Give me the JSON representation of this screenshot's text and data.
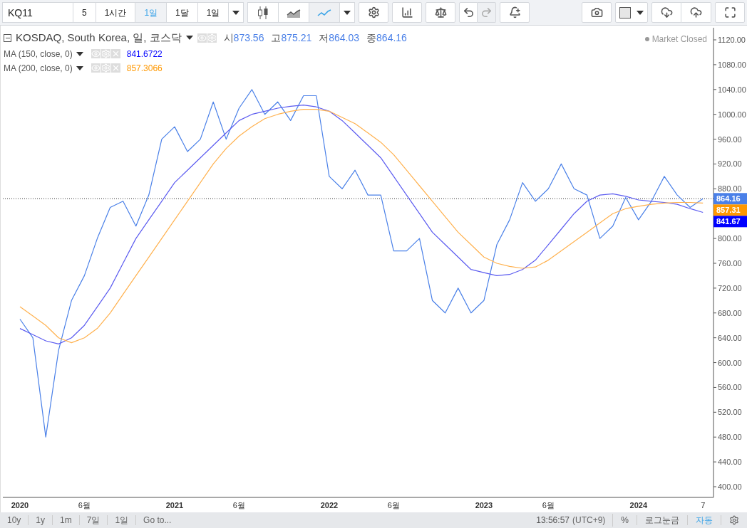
{
  "toolbar": {
    "symbol": "KQ11",
    "intervals": [
      {
        "label": "5",
        "selected": false
      },
      {
        "label": "1시간",
        "selected": false
      },
      {
        "label": "1일",
        "selected": true
      },
      {
        "label": "1달",
        "selected": false
      },
      {
        "label": "1일",
        "selected": false
      }
    ],
    "chart_styles": [
      {
        "kind": "candles",
        "selected": false
      },
      {
        "kind": "area",
        "selected": false
      },
      {
        "kind": "line",
        "selected": true
      }
    ],
    "left_tools": [
      [
        {
          "kind": "settings"
        }
      ],
      [
        {
          "kind": "indicators"
        }
      ],
      [
        {
          "kind": "compare"
        }
      ],
      [
        {
          "kind": "undo",
          "disabled": false
        },
        {
          "kind": "redo",
          "disabled": true
        }
      ],
      [
        {
          "kind": "alert"
        }
      ]
    ],
    "right_tools": [
      [
        {
          "kind": "snapshot"
        }
      ],
      [
        {
          "kind": "color"
        }
      ],
      [
        {
          "kind": "download"
        },
        {
          "kind": "upload"
        }
      ],
      [
        {
          "kind": "fullscreen"
        }
      ]
    ]
  },
  "legend": {
    "title": "KOSDAQ, South Korea, 일, 코스닥",
    "ohlc": [
      {
        "label": "시",
        "value": "873.56"
      },
      {
        "label": "고",
        "value": "875.21"
      },
      {
        "label": "저",
        "value": "864.03"
      },
      {
        "label": "종",
        "value": "864.16"
      }
    ],
    "indicators": [
      {
        "value": "841.6722",
        "color": "#0000ff"
      },
      {
        "value": "857.3066",
        "color": "#ff9800"
      }
    ],
    "market_status": "Market Closed"
  },
  "chart": {
    "last_value_labels": [
      {
        "value": "864.16",
        "color": "#4a80e8"
      },
      {
        "value": "857.31",
        "color": "#ff9800"
      },
      {
        "value": "841.67",
        "color": "#0000ff"
      }
    ],
    "chart_data": {
      "type": "line",
      "categories": [
        "2020",
        null,
        null,
        null,
        null,
        "6월",
        null,
        null,
        null,
        null,
        null,
        null,
        "2021",
        null,
        null,
        null,
        null,
        "6월",
        null,
        null,
        null,
        null,
        null,
        null,
        "2022",
        null,
        null,
        null,
        null,
        "6월",
        null,
        null,
        null,
        null,
        null,
        null,
        "2023",
        null,
        null,
        null,
        null,
        "6월",
        null,
        null,
        null,
        null,
        null,
        null,
        "2024",
        null,
        null,
        null,
        null,
        "7"
      ],
      "series": [
        {
          "color": "#4a80e8",
          "values": [
            670,
            640,
            480,
            620,
            700,
            740,
            800,
            850,
            860,
            820,
            870,
            960,
            980,
            940,
            960,
            1020,
            960,
            1010,
            1040,
            1000,
            1020,
            990,
            1030,
            1030,
            900,
            880,
            910,
            870,
            870,
            780,
            780,
            800,
            700,
            680,
            720,
            680,
            700,
            790,
            830,
            890,
            860,
            880,
            920,
            880,
            870,
            800,
            820,
            866,
            830,
            860,
            900,
            870,
            850,
            864
          ]
        },
        {
          "name": "MA (150, close, 0)",
          "color": "#5c5cf0",
          "values": [
            655,
            645,
            635,
            630,
            640,
            660,
            690,
            720,
            760,
            800,
            830,
            860,
            890,
            910,
            930,
            950,
            970,
            990,
            1000,
            1005,
            1010,
            1013,
            1015,
            1012,
            1005,
            990,
            970,
            950,
            930,
            900,
            870,
            840,
            810,
            790,
            770,
            750,
            745,
            740,
            742,
            750,
            765,
            790,
            815,
            840,
            860,
            870,
            872,
            868,
            862,
            860,
            858,
            855,
            848,
            842
          ]
        },
        {
          "name": "MA (200, close, 0)",
          "color": "#ffb14e",
          "values": [
            690,
            675,
            660,
            640,
            632,
            640,
            655,
            680,
            710,
            740,
            770,
            800,
            830,
            860,
            890,
            920,
            945,
            965,
            980,
            993,
            1000,
            1005,
            1008,
            1008,
            1005,
            995,
            985,
            970,
            955,
            935,
            910,
            885,
            860,
            835,
            810,
            790,
            770,
            760,
            755,
            752,
            754,
            765,
            780,
            795,
            810,
            825,
            840,
            848,
            852,
            855,
            857,
            858,
            858,
            857
          ]
        }
      ],
      "yticks": [
        {
          "value": 400,
          "label": "400.00"
        },
        {
          "value": 440,
          "label": "440.00"
        },
        {
          "value": 480,
          "label": "480.00"
        },
        {
          "value": 520,
          "label": "520.00"
        },
        {
          "value": 560,
          "label": "560.00"
        },
        {
          "value": 600,
          "label": "600.00"
        },
        {
          "value": 640,
          "label": "640.00"
        },
        {
          "value": 680,
          "label": "680.00"
        },
        {
          "value": 720,
          "label": "720.00"
        },
        {
          "value": 760,
          "label": "760.00"
        },
        {
          "value": 800,
          "label": "800.00"
        },
        {
          "value": 880,
          "label": "880.00"
        },
        {
          "value": 920,
          "label": "920.00"
        },
        {
          "value": 960,
          "label": "960.00"
        },
        {
          "value": 1000,
          "label": "1000.00"
        },
        {
          "value": 1040,
          "label": "1040.00"
        },
        {
          "value": 1080,
          "label": "1080.00"
        },
        {
          "value": 1120,
          "label": "1120.00"
        }
      ],
      "ref_lines": [
        {
          "axis": "y",
          "value": 864.16
        }
      ],
      "ylim": [
        382.8,
        1139.5
      ]
    }
  },
  "bottom_bar": {
    "ranges": [
      "10y",
      "1y",
      "1m",
      "7일",
      "1일"
    ],
    "goto": "Go to...",
    "time": "13:56:57",
    "timezone": "(UTC+9)",
    "options": [
      {
        "label": "%",
        "selected": false
      },
      {
        "label": "로그눈금",
        "selected": false
      },
      {
        "label": "자동",
        "selected": true
      }
    ]
  }
}
